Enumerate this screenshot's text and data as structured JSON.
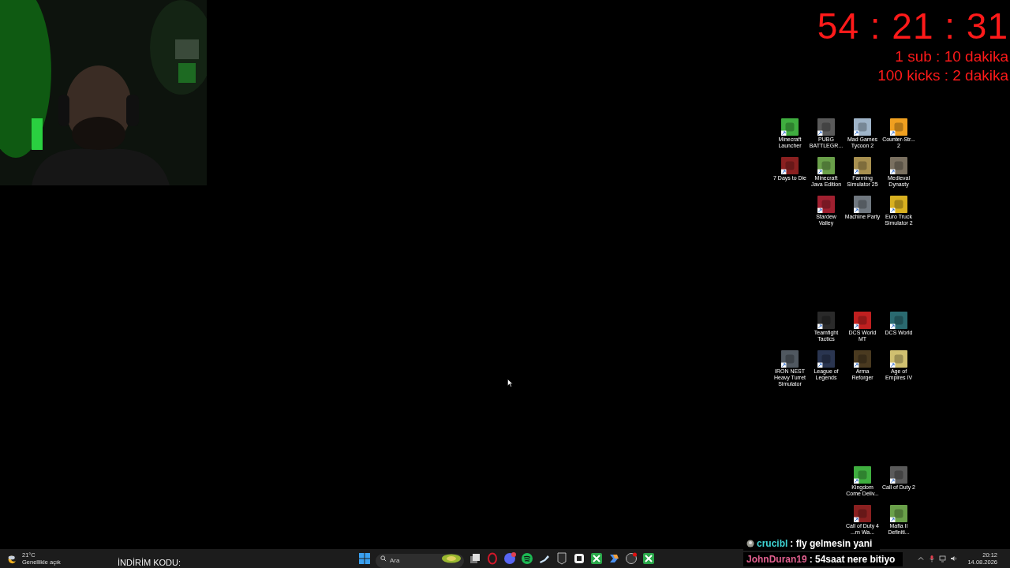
{
  "timer": {
    "time": "54 : 21 : 31",
    "lines": [
      "1 sub : 10 dakika",
      "100 kicks : 2 dakika"
    ]
  },
  "desktop_icons": [
    {
      "rows": [
        [
          {
            "label": "Minecraft Launcher"
          },
          {
            "label": "PUBG BATTLEGR..."
          },
          {
            "label": "Mad Games Tycoon 2"
          },
          {
            "label": "Counter-Str... 2"
          }
        ],
        [
          {
            "label": "7 Days to Die"
          },
          {
            "label": "Minecraft Java Edition"
          },
          {
            "label": "Farming Simulator 25"
          },
          {
            "label": "Medieval Dynasty"
          }
        ],
        [
          "",
          {
            "label": "Stardew Valley"
          },
          {
            "label": "Machine Party"
          },
          {
            "label": "Euro Truck Simulator 2"
          }
        ]
      ]
    },
    {
      "rows": [
        [
          "",
          {
            "label": "Teamfight Tactics"
          },
          {
            "label": "DCS World MT"
          },
          {
            "label": "DCS World"
          }
        ],
        [
          {
            "label": "IRON NEST Heavy Turret Simulator"
          },
          {
            "label": "League of Legends"
          },
          {
            "label": "Arma Reforger"
          },
          {
            "label": "Age of Empires IV"
          }
        ]
      ]
    },
    {
      "rows": [
        [
          "",
          "",
          {
            "label": "Kingdom Come Deliv..."
          },
          {
            "label": "Call of Duty 2"
          }
        ],
        [
          "",
          "",
          {
            "label": "Call of Duty 4 ...rn Wa..."
          },
          {
            "label": "Mafia II Definiti..."
          }
        ]
      ]
    }
  ],
  "chat": [
    {
      "user": "crucibl",
      "text": ": fly gelmesin yani",
      "color": "#3ed3d3",
      "badge": true
    },
    {
      "user": "JohnDuran19",
      "text": ": 54saat nere bitiyo",
      "color": "#e2608f",
      "badge": false
    }
  ],
  "taskbar": {
    "weather": {
      "temp": "21°C",
      "condition": "Genellikle açık"
    },
    "promo": "İNDİRİM KODU:",
    "search": {
      "placeholder": "Ara"
    },
    "clock": {
      "time": "20:12",
      "date": "14.08.2026"
    }
  }
}
